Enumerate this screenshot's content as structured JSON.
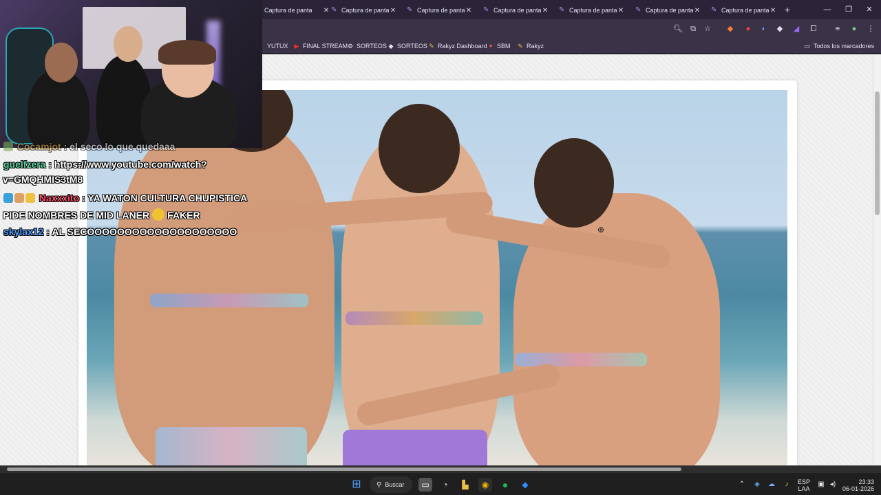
{
  "browser": {
    "tabs": [
      {
        "label": "Captura de panta",
        "favicon": "feather-icon"
      },
      {
        "label": "Captura de panta",
        "favicon": "feather-icon"
      },
      {
        "label": "Captura de panta",
        "favicon": "feather-icon"
      },
      {
        "label": "Captura de panta",
        "favicon": "feather-icon"
      },
      {
        "label": "Captura de panta",
        "favicon": "feather-icon"
      },
      {
        "label": "Captura de panta",
        "favicon": "feather-icon"
      },
      {
        "label": "Captura de panta",
        "favicon": "feather-icon"
      }
    ],
    "tab_close_glyph": "✕",
    "new_tab_glyph": "+",
    "window_controls": {
      "minimize": "—",
      "maximize": "❐",
      "close": "✕"
    },
    "bookmarks": [
      {
        "label": "YUTUX"
      },
      {
        "label": "FINAL STREAM"
      },
      {
        "label": "SORTEOS"
      },
      {
        "label": "SORTEOS"
      },
      {
        "label": "Rakyz Dashboard"
      },
      {
        "label": "SBM"
      },
      {
        "label": "Rakyz"
      }
    ],
    "all_bookmarks_label": "Todos los marcadores"
  },
  "chat": {
    "messages": [
      {
        "user": "Cocamjot",
        "text": ": el seco lo que quedaaa",
        "user_color": "#d6a84a"
      },
      {
        "user": "guelfzera",
        "text": ": https://www.youtube.com/watch?",
        "user_color": "#5fd0a0"
      },
      {
        "user": "",
        "text": "v=GMQHMIS3tM8",
        "user_color": "#ffffff"
      },
      {
        "user": "Naxxxito",
        "text": ": YA WATON CULTURA CHUPISTICA",
        "user_color": "#ff4d6a"
      },
      {
        "user": "",
        "text": "PIDE NOMBRES DE MID LANER",
        "suffix": "FAKER",
        "user_color": "#ffffff"
      },
      {
        "user": "skylax12",
        "text": ": AL SECOOOOOOOOOOOOOOOOOOOO",
        "user_color": "#4d9cff"
      }
    ]
  },
  "taskbar": {
    "search_label": "Buscar",
    "language": "ESP",
    "layout": "LAA",
    "time": "23:33",
    "date": "06-01-2026"
  },
  "colors": {
    "tabbar": "#2b2438",
    "toolbar": "#3a3247",
    "taskbar": "#1f1f1f",
    "accent": "#b48cf0"
  }
}
